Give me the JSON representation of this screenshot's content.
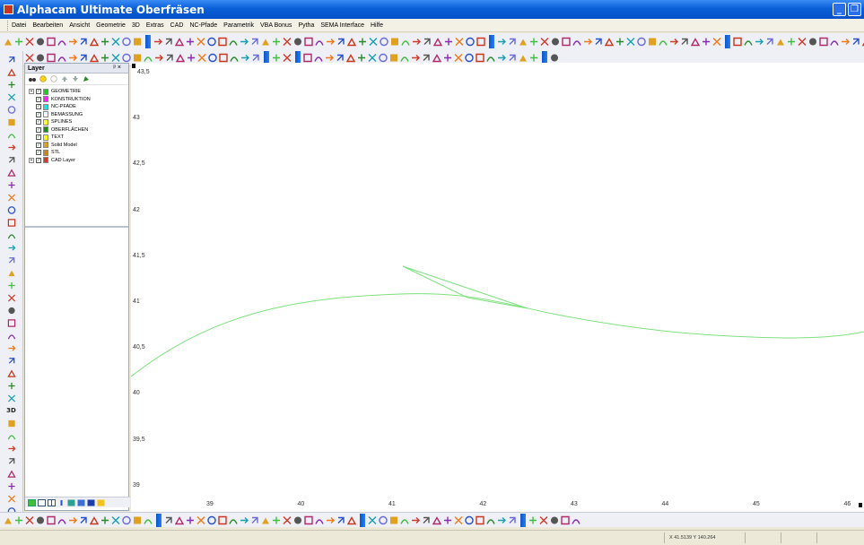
{
  "window": {
    "title": "Alphacam Ultimate Oberfräsen"
  },
  "menu": [
    "Datei",
    "Bearbeiten",
    "Ansicht",
    "Geometrie",
    "3D",
    "Extras",
    "CAD",
    "NC-Pfade",
    "Parametrik",
    "VBA Bonus",
    "Pytha",
    "SEMA Interface",
    "Hilfe"
  ],
  "layer_panel": {
    "title": "Layer",
    "header_controls": "ᵖ ×",
    "layers": [
      {
        "name": "GEOMETRIE",
        "color": "#22c722",
        "checked": true,
        "expandable": true
      },
      {
        "name": "KONSTRUKTION",
        "color": "#ff22ff",
        "checked": true,
        "expandable": false
      },
      {
        "name": "NC-PFADE",
        "color": "#22e0e0",
        "checked": true,
        "expandable": false
      },
      {
        "name": "BEMASSUNG",
        "color": "#ffffff",
        "checked": true,
        "expandable": false
      },
      {
        "name": "SPLINES",
        "color": "#ffff22",
        "checked": true,
        "expandable": false
      },
      {
        "name": "OBERFLÄCHEN",
        "color": "#1a8f1a",
        "checked": true,
        "expandable": false
      },
      {
        "name": "TEXT",
        "color": "#ffff00",
        "checked": true,
        "expandable": false
      },
      {
        "name": "Solid Model",
        "color": "#d9a21f",
        "checked": true,
        "expandable": false
      },
      {
        "name": "STL",
        "color": "#c98818",
        "checked": true,
        "expandable": false
      },
      {
        "name": "CAD Layer",
        "color": "#d23a2a",
        "checked": true,
        "expandable": true
      }
    ]
  },
  "drawing": {
    "y_ticks": [
      "43,5",
      "43",
      "42,5",
      "42",
      "41,5",
      "41",
      "40,5",
      "40",
      "39,5",
      "39"
    ],
    "x_ticks": [
      "39",
      "40",
      "41",
      "42",
      "43",
      "44",
      "45",
      "46"
    ],
    "geometry_color": "#7ee07e"
  },
  "status": {
    "coordinates": "X 41.5139    Y 140.264"
  }
}
